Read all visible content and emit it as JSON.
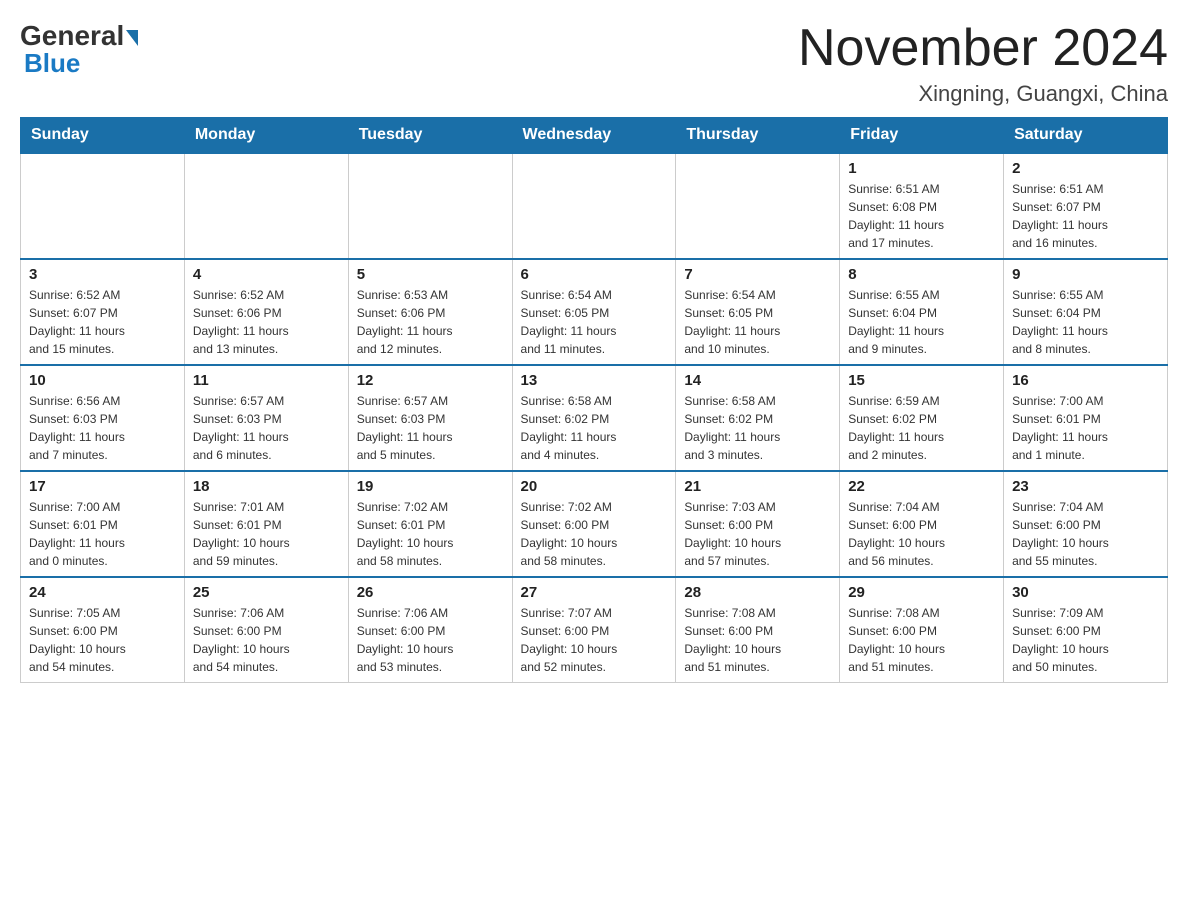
{
  "header": {
    "logo": {
      "general": "General",
      "blue": "Blue"
    },
    "title": "November 2024",
    "location": "Xingning, Guangxi, China"
  },
  "days_of_week": [
    "Sunday",
    "Monday",
    "Tuesday",
    "Wednesday",
    "Thursday",
    "Friday",
    "Saturday"
  ],
  "weeks": [
    [
      {
        "day": "",
        "info": ""
      },
      {
        "day": "",
        "info": ""
      },
      {
        "day": "",
        "info": ""
      },
      {
        "day": "",
        "info": ""
      },
      {
        "day": "",
        "info": ""
      },
      {
        "day": "1",
        "info": "Sunrise: 6:51 AM\nSunset: 6:08 PM\nDaylight: 11 hours\nand 17 minutes."
      },
      {
        "day": "2",
        "info": "Sunrise: 6:51 AM\nSunset: 6:07 PM\nDaylight: 11 hours\nand 16 minutes."
      }
    ],
    [
      {
        "day": "3",
        "info": "Sunrise: 6:52 AM\nSunset: 6:07 PM\nDaylight: 11 hours\nand 15 minutes."
      },
      {
        "day": "4",
        "info": "Sunrise: 6:52 AM\nSunset: 6:06 PM\nDaylight: 11 hours\nand 13 minutes."
      },
      {
        "day": "5",
        "info": "Sunrise: 6:53 AM\nSunset: 6:06 PM\nDaylight: 11 hours\nand 12 minutes."
      },
      {
        "day": "6",
        "info": "Sunrise: 6:54 AM\nSunset: 6:05 PM\nDaylight: 11 hours\nand 11 minutes."
      },
      {
        "day": "7",
        "info": "Sunrise: 6:54 AM\nSunset: 6:05 PM\nDaylight: 11 hours\nand 10 minutes."
      },
      {
        "day": "8",
        "info": "Sunrise: 6:55 AM\nSunset: 6:04 PM\nDaylight: 11 hours\nand 9 minutes."
      },
      {
        "day": "9",
        "info": "Sunrise: 6:55 AM\nSunset: 6:04 PM\nDaylight: 11 hours\nand 8 minutes."
      }
    ],
    [
      {
        "day": "10",
        "info": "Sunrise: 6:56 AM\nSunset: 6:03 PM\nDaylight: 11 hours\nand 7 minutes."
      },
      {
        "day": "11",
        "info": "Sunrise: 6:57 AM\nSunset: 6:03 PM\nDaylight: 11 hours\nand 6 minutes."
      },
      {
        "day": "12",
        "info": "Sunrise: 6:57 AM\nSunset: 6:03 PM\nDaylight: 11 hours\nand 5 minutes."
      },
      {
        "day": "13",
        "info": "Sunrise: 6:58 AM\nSunset: 6:02 PM\nDaylight: 11 hours\nand 4 minutes."
      },
      {
        "day": "14",
        "info": "Sunrise: 6:58 AM\nSunset: 6:02 PM\nDaylight: 11 hours\nand 3 minutes."
      },
      {
        "day": "15",
        "info": "Sunrise: 6:59 AM\nSunset: 6:02 PM\nDaylight: 11 hours\nand 2 minutes."
      },
      {
        "day": "16",
        "info": "Sunrise: 7:00 AM\nSunset: 6:01 PM\nDaylight: 11 hours\nand 1 minute."
      }
    ],
    [
      {
        "day": "17",
        "info": "Sunrise: 7:00 AM\nSunset: 6:01 PM\nDaylight: 11 hours\nand 0 minutes."
      },
      {
        "day": "18",
        "info": "Sunrise: 7:01 AM\nSunset: 6:01 PM\nDaylight: 10 hours\nand 59 minutes."
      },
      {
        "day": "19",
        "info": "Sunrise: 7:02 AM\nSunset: 6:01 PM\nDaylight: 10 hours\nand 58 minutes."
      },
      {
        "day": "20",
        "info": "Sunrise: 7:02 AM\nSunset: 6:00 PM\nDaylight: 10 hours\nand 58 minutes."
      },
      {
        "day": "21",
        "info": "Sunrise: 7:03 AM\nSunset: 6:00 PM\nDaylight: 10 hours\nand 57 minutes."
      },
      {
        "day": "22",
        "info": "Sunrise: 7:04 AM\nSunset: 6:00 PM\nDaylight: 10 hours\nand 56 minutes."
      },
      {
        "day": "23",
        "info": "Sunrise: 7:04 AM\nSunset: 6:00 PM\nDaylight: 10 hours\nand 55 minutes."
      }
    ],
    [
      {
        "day": "24",
        "info": "Sunrise: 7:05 AM\nSunset: 6:00 PM\nDaylight: 10 hours\nand 54 minutes."
      },
      {
        "day": "25",
        "info": "Sunrise: 7:06 AM\nSunset: 6:00 PM\nDaylight: 10 hours\nand 54 minutes."
      },
      {
        "day": "26",
        "info": "Sunrise: 7:06 AM\nSunset: 6:00 PM\nDaylight: 10 hours\nand 53 minutes."
      },
      {
        "day": "27",
        "info": "Sunrise: 7:07 AM\nSunset: 6:00 PM\nDaylight: 10 hours\nand 52 minutes."
      },
      {
        "day": "28",
        "info": "Sunrise: 7:08 AM\nSunset: 6:00 PM\nDaylight: 10 hours\nand 51 minutes."
      },
      {
        "day": "29",
        "info": "Sunrise: 7:08 AM\nSunset: 6:00 PM\nDaylight: 10 hours\nand 51 minutes."
      },
      {
        "day": "30",
        "info": "Sunrise: 7:09 AM\nSunset: 6:00 PM\nDaylight: 10 hours\nand 50 minutes."
      }
    ]
  ]
}
